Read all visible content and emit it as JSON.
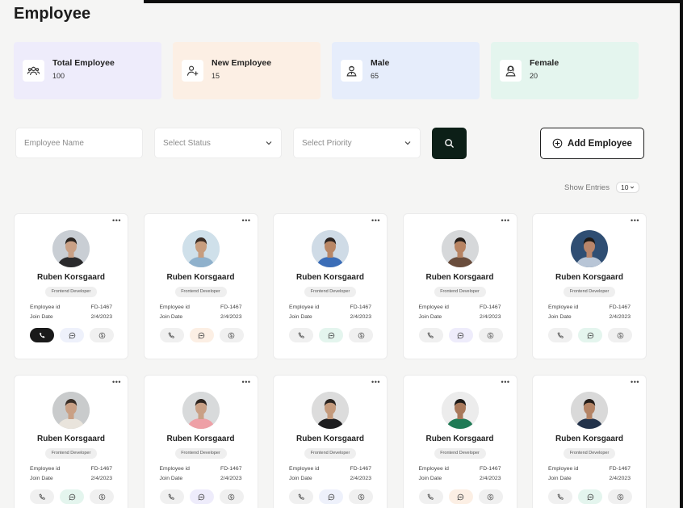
{
  "page": {
    "title": "Employee"
  },
  "stats": [
    {
      "label": "Total Employee",
      "value": "100",
      "icon": "users-icon",
      "bg": "#eeecfb"
    },
    {
      "label": "New Employee",
      "value": "15",
      "icon": "add-user-icon",
      "bg": "#fcefe4"
    },
    {
      "label": "Male",
      "value": "65",
      "icon": "male-user-icon",
      "bg": "#e6edfb"
    },
    {
      "label": "Female",
      "value": "20",
      "icon": "female-user-icon",
      "bg": "#e4f5ee"
    }
  ],
  "filters": {
    "name_placeholder": "Employee Name",
    "status_placeholder": "Select Status",
    "priority_placeholder": "Select Priority",
    "add_label": "Add Employee"
  },
  "entries": {
    "label": "Show Entries",
    "value": "10"
  },
  "card_labels": {
    "employee_id": "Employee id",
    "join_date": "Join Date",
    "more": "•••"
  },
  "employees": [
    {
      "name": "Ruben Korsgaard",
      "role": "Frontend Developer",
      "id": "FD-1467",
      "join": "2/4/2023",
      "bg": "#c9ced4",
      "shirt": "#2a2a2c",
      "skin": "#c9a085",
      "hair": "#2a2420",
      "msg_bg": "#eef1fb",
      "call_active": true
    },
    {
      "name": "Ruben Korsgaard",
      "role": "Frontend Developer",
      "id": "FD-1467",
      "join": "2/4/2023",
      "bg": "#cfe0ea",
      "shirt": "#8fb1cc",
      "skin": "#c79d7e",
      "hair": "#3a2c24",
      "msg_bg": "#fcefe4",
      "call_active": false
    },
    {
      "name": "Ruben Korsgaard",
      "role": "Frontend Developer",
      "id": "FD-1467",
      "join": "2/4/2023",
      "bg": "#cfdbe6",
      "shirt": "#3b6db7",
      "skin": "#b98766",
      "hair": "#2b2320",
      "msg_bg": "#e4f5ee",
      "call_active": false
    },
    {
      "name": "Ruben Korsgaard",
      "role": "Frontend Developer",
      "id": "FD-1467",
      "join": "2/4/2023",
      "bg": "#d6d8da",
      "shirt": "#6a4d3c",
      "skin": "#b88463",
      "hair": "#241d19",
      "msg_bg": "#eeecfb",
      "call_active": false
    },
    {
      "name": "Ruben Korsgaard",
      "role": "Frontend Developer",
      "id": "FD-1467",
      "join": "2/4/2023",
      "bg": "#2f4e73",
      "shirt": "#b8c5d6",
      "skin": "#b9856a",
      "hair": "#1d1a18",
      "msg_bg": "#e4f5ee",
      "call_active": false
    },
    {
      "name": "Ruben Korsgaard",
      "role": "Frontend Developer",
      "id": "FD-1467",
      "join": "2/4/2023",
      "bg": "#c9cbcc",
      "shirt": "#e9e4dc",
      "skin": "#c9a085",
      "hair": "#3a2f28",
      "msg_bg": "#e4f5ee",
      "call_active": false
    },
    {
      "name": "Ruben Korsgaard",
      "role": "Frontend Developer",
      "id": "FD-1467",
      "join": "2/4/2023",
      "bg": "#d8dadb",
      "shirt": "#eea0a6",
      "skin": "#c9a085",
      "hair": "#2e2520",
      "msg_bg": "#eeecfb",
      "call_active": false
    },
    {
      "name": "Ruben Korsgaard",
      "role": "Frontend Developer",
      "id": "FD-1467",
      "join": "2/4/2023",
      "bg": "#dcdcdc",
      "shirt": "#1d1d1f",
      "skin": "#c49a7c",
      "hair": "#2a2420",
      "msg_bg": "#eef1fb",
      "call_active": false
    },
    {
      "name": "Ruben Korsgaard",
      "role": "Frontend Developer",
      "id": "FD-1467",
      "join": "2/4/2023",
      "bg": "#ececec",
      "shirt": "#1f7a55",
      "skin": "#a9795b",
      "hair": "#1d1a18",
      "msg_bg": "#fcefe4",
      "call_active": false
    },
    {
      "name": "Ruben Korsgaard",
      "role": "Frontend Developer",
      "id": "FD-1467",
      "join": "2/4/2023",
      "bg": "#d9d9d9",
      "shirt": "#22324a",
      "skin": "#b48466",
      "hair": "#241d19",
      "msg_bg": "#e4f5ee",
      "call_active": false
    }
  ]
}
